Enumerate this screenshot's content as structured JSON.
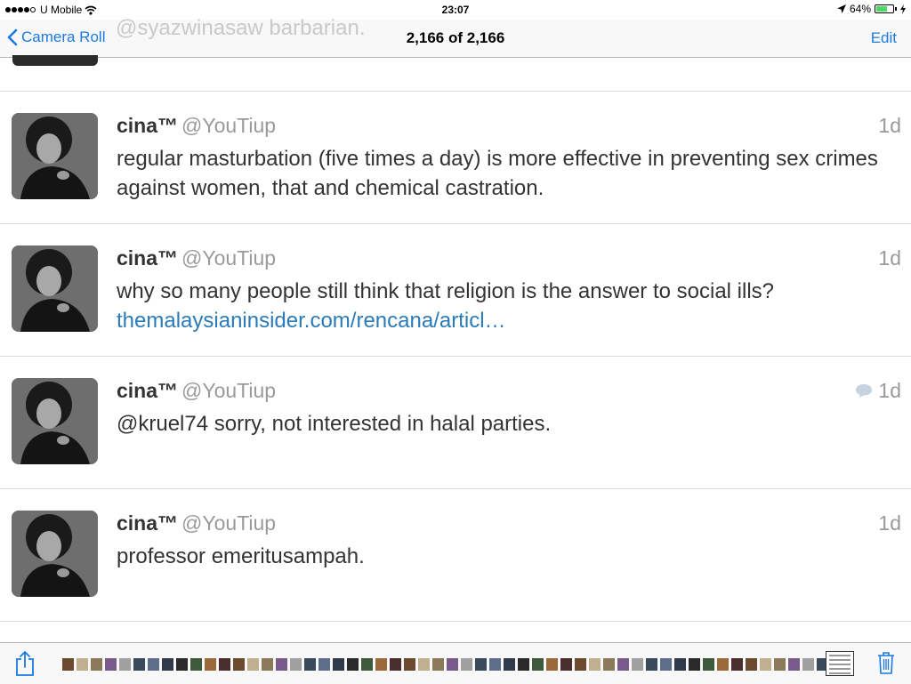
{
  "status_bar": {
    "carrier": "U Mobile",
    "time": "23:07",
    "battery_percent": "64%",
    "battery_level": 0.64
  },
  "nav": {
    "back_label": "Camera Roll",
    "title": "2,166 of 2,166",
    "edit_label": "Edit",
    "ghost_text": "@syazwinasaw barbarian."
  },
  "tweets": [
    {
      "name": "cina™",
      "handle": "@YouTiup",
      "time": "1d",
      "text": "regular masturbation (five times a day) is more effective in preventing sex crimes against women, that and chemical castration.",
      "link": "",
      "has_reply_icon": false
    },
    {
      "name": "cina™",
      "handle": "@YouTiup",
      "time": "1d",
      "text": "why so many people still think that religion is the answer to social ills?",
      "link": "themalaysianinsider.com/rencana/articl…",
      "has_reply_icon": false
    },
    {
      "name": "cina™",
      "handle": "@YouTiup",
      "time": "1d",
      "text": "@kruel74 sorry, not interested in halal parties.",
      "link": "",
      "has_reply_icon": true
    },
    {
      "name": "cina™",
      "handle": "@YouTiup",
      "time": "1d",
      "text": "professor emeritusampah.",
      "link": "",
      "has_reply_icon": false
    }
  ],
  "colors": {
    "accent": "#1a7ae0",
    "link": "#2b7bb9",
    "muted": "#9a9a9a"
  },
  "icons": {
    "share": "share-icon",
    "trash": "trash-icon",
    "back": "chevron-left-icon",
    "reply": "conversation-icon",
    "wifi": "wifi-icon",
    "location": "location-arrow-icon",
    "battery": "battery-icon"
  }
}
